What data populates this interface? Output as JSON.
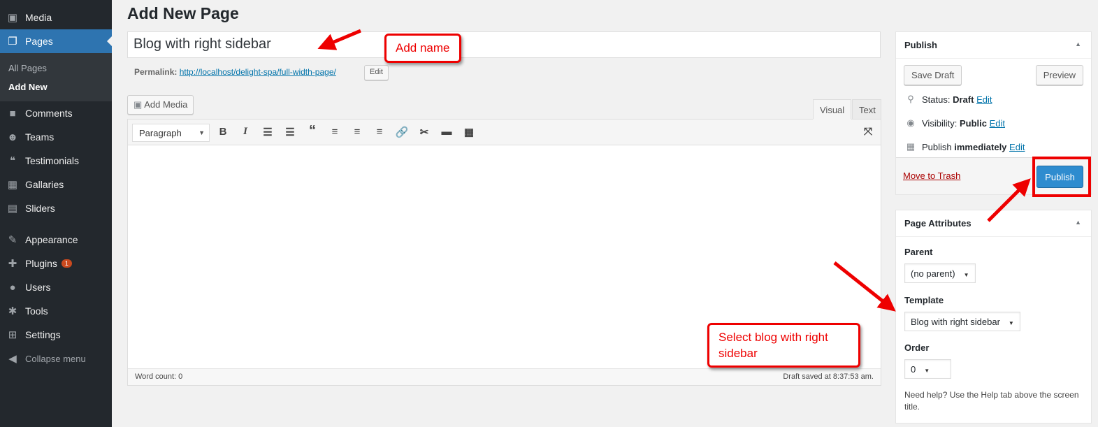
{
  "sidebar": {
    "items": [
      {
        "label": "Media",
        "icon": "media-icon",
        "glyph": "▣"
      },
      {
        "label": "Pages",
        "icon": "pages-icon",
        "glyph": "❐"
      },
      {
        "label": "Comments",
        "icon": "comments-icon",
        "glyph": "■"
      },
      {
        "label": "Teams",
        "icon": "teams-icon",
        "glyph": "☻"
      },
      {
        "label": "Testimonials",
        "icon": "testimonials-icon",
        "glyph": "❝"
      },
      {
        "label": "Gallaries",
        "icon": "gallery-icon",
        "glyph": "▦"
      },
      {
        "label": "Sliders",
        "icon": "sliders-icon",
        "glyph": "▤"
      },
      {
        "label": "Appearance",
        "icon": "appearance-icon",
        "glyph": "✎"
      },
      {
        "label": "Plugins",
        "icon": "plugins-icon",
        "glyph": "⚡",
        "badge": "1"
      },
      {
        "label": "Users",
        "icon": "users-icon",
        "glyph": "👤"
      },
      {
        "label": "Tools",
        "icon": "tools-icon",
        "glyph": "🔧"
      },
      {
        "label": "Settings",
        "icon": "settings-icon",
        "glyph": "⊞"
      },
      {
        "label": "Collapse menu",
        "icon": "collapse-icon",
        "glyph": "◀"
      }
    ],
    "submenu": [
      "All Pages",
      "Add New"
    ]
  },
  "page": {
    "title": "Add New Page",
    "post_title": "Blog with right sidebar",
    "permalink_label": "Permalink:",
    "permalink_url": "http://localhost/delight-spa/full-width-page/",
    "edit_label": "Edit"
  },
  "editor": {
    "add_media": "Add Media",
    "tabs": [
      "Visual",
      "Text"
    ],
    "format": "Paragraph",
    "word_count": "Word count: 0",
    "draft_saved": "Draft saved at 8:37:53 am."
  },
  "publish": {
    "title": "Publish",
    "save_draft": "Save Draft",
    "preview": "Preview",
    "status_label": "Status:",
    "status": "Draft",
    "visibility_label": "Visibility:",
    "visibility": "Public",
    "publish_label": "Publish",
    "publish_when": "immediately",
    "edit": "Edit",
    "trash": "Move to Trash",
    "publish_button": "Publish"
  },
  "attributes": {
    "title": "Page Attributes",
    "parent_label": "Parent",
    "parent": "(no parent)",
    "template_label": "Template",
    "template": "Blog with right sidebar",
    "order_label": "Order",
    "order": "0",
    "help": "Need help? Use the Help tab above the screen title."
  },
  "annotations": {
    "add_name": "Add name",
    "select_template": "Select blog with right sidebar",
    "color": "#e00000"
  }
}
